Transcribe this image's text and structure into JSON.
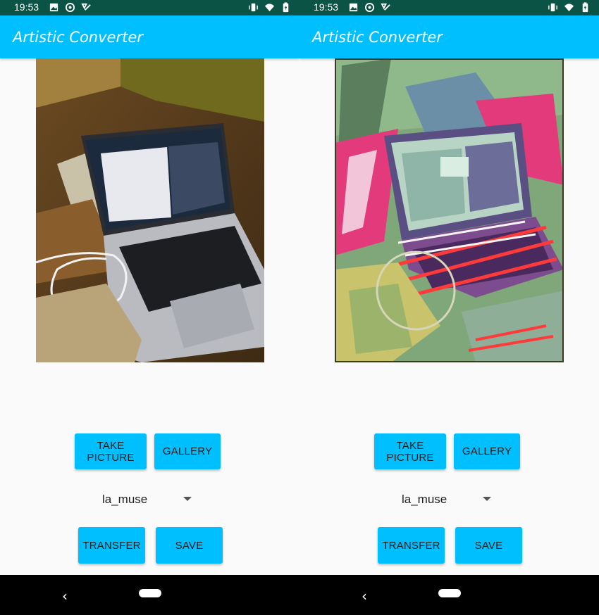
{
  "screens": [
    {
      "status_bar": {
        "time": "19:53",
        "left_icons": [
          "image-icon",
          "at-sign-icon",
          "check-icon"
        ],
        "right_icons": [
          "vibrate-icon",
          "wifi-icon",
          "battery-icon"
        ]
      },
      "app_bar": {
        "title": "Artistic Converter"
      },
      "image": {
        "description_icon": "laptop-photo",
        "style": "original"
      },
      "buttons": {
        "take_picture": "TAKE PICTURE",
        "gallery": "GALLERY",
        "transfer": "TRANSFER",
        "save": "SAVE"
      },
      "style_spinner": {
        "selected": "la_muse"
      },
      "nav_bar": {
        "back_icon": "back-icon",
        "home_icon": "home-pill-icon"
      }
    },
    {
      "status_bar": {
        "time": "19:53",
        "left_icons": [
          "image-icon",
          "at-sign-icon",
          "check-icon"
        ],
        "right_icons": [
          "vibrate-icon",
          "wifi-icon",
          "battery-icon"
        ]
      },
      "app_bar": {
        "title": "Artistic Converter"
      },
      "image": {
        "description_icon": "laptop-photo-stylized",
        "style": "la_muse"
      },
      "buttons": {
        "take_picture": "TAKE PICTURE",
        "gallery": "GALLERY",
        "transfer": "TRANSFER",
        "save": "SAVE"
      },
      "style_spinner": {
        "selected": "la_muse"
      },
      "nav_bar": {
        "back_icon": "back-icon",
        "home_icon": "home-pill-icon"
      }
    }
  ],
  "colors": {
    "status_bar": "#0b5345",
    "accent": "#00bfff",
    "background": "#fafafa",
    "nav_bar": "#000000"
  }
}
